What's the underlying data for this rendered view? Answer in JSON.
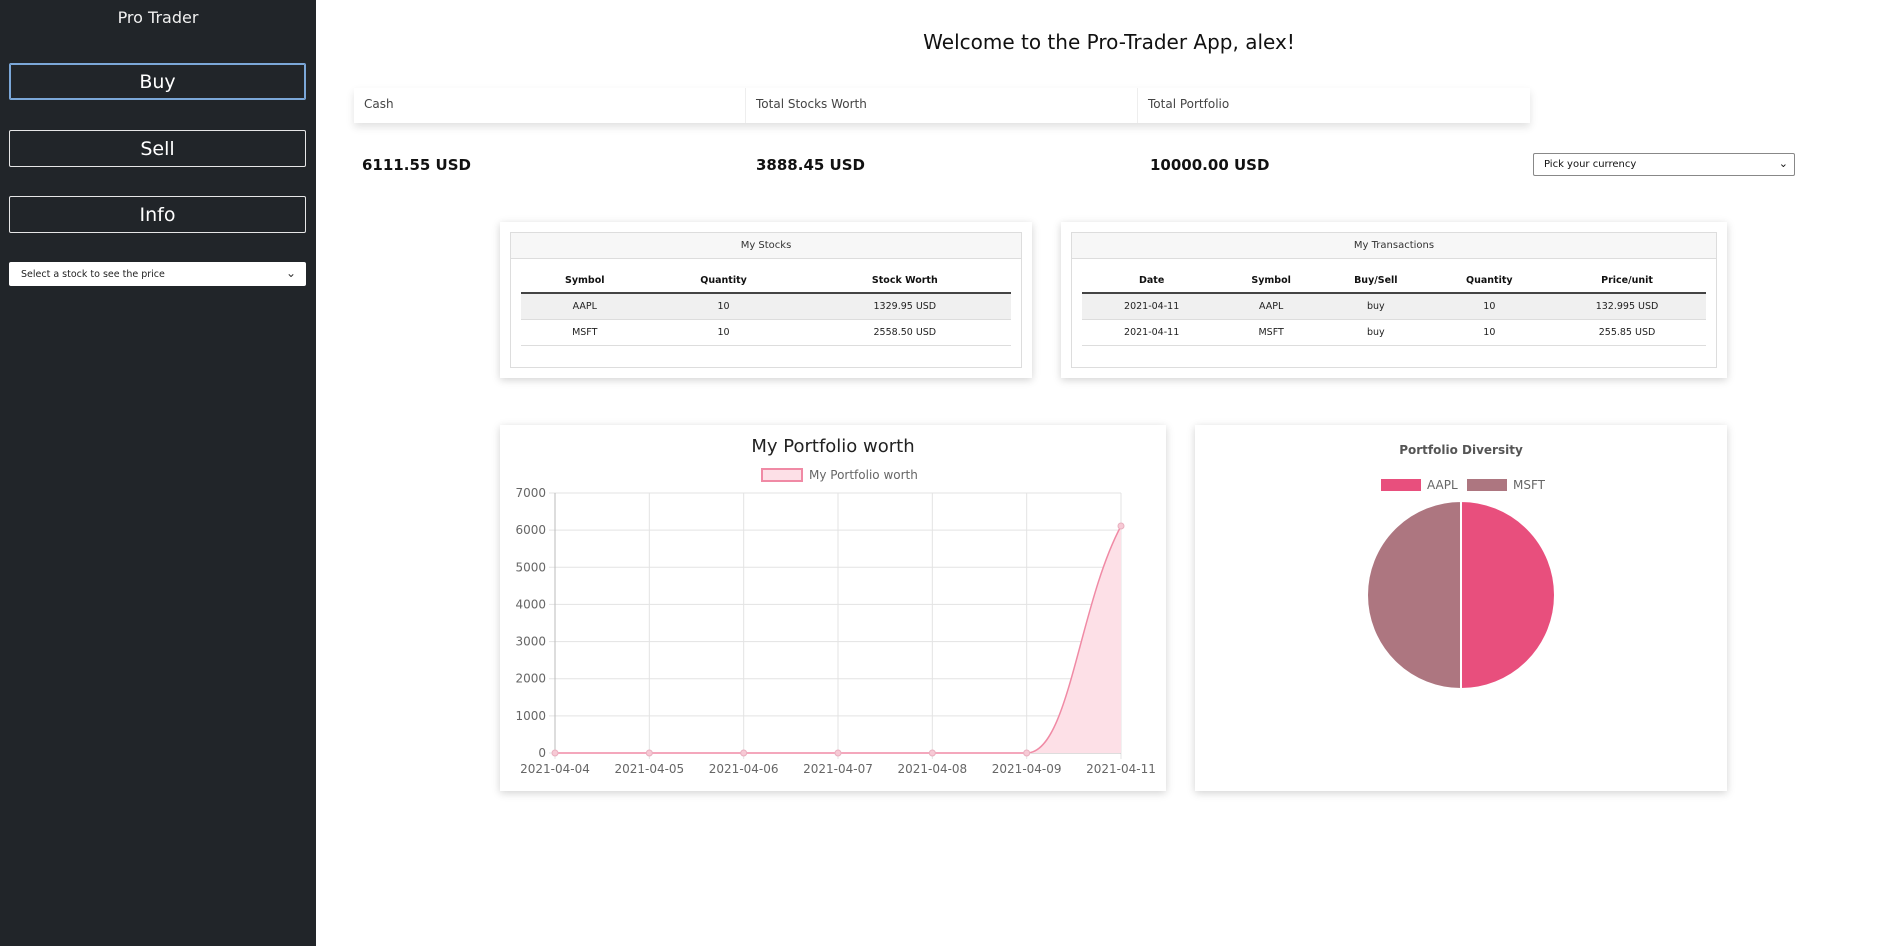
{
  "sidebar": {
    "brand": "Pro Trader",
    "buy_label": "Buy",
    "sell_label": "Sell",
    "info_label": "Info",
    "stock_select_placeholder": "Select a stock to see the price"
  },
  "main": {
    "welcome": "Welcome to the Pro-Trader App, alex!",
    "stats": {
      "cash_label": "Cash",
      "stocks_label": "Total Stocks Worth",
      "portfolio_label": "Total Portfolio",
      "cash_value": "6111.55 USD",
      "stocks_value": "3888.45 USD",
      "portfolio_value": "10000.00 USD"
    },
    "currency_placeholder": "Pick your currency"
  },
  "my_stocks": {
    "title": "My Stocks",
    "headers": [
      "Symbol",
      "Quantity",
      "Stock Worth"
    ],
    "rows": [
      [
        "AAPL",
        "10",
        "1329.95 USD"
      ],
      [
        "MSFT",
        "10",
        "2558.50 USD"
      ]
    ]
  },
  "my_transactions": {
    "title": "My Transactions",
    "headers": [
      "Date",
      "Symbol",
      "Buy/Sell",
      "Quantity",
      "Price/unit"
    ],
    "rows": [
      [
        "2021-04-11",
        "AAPL",
        "buy",
        "10",
        "132.995 USD"
      ],
      [
        "2021-04-11",
        "MSFT",
        "buy",
        "10",
        "255.85 USD"
      ]
    ]
  },
  "colors": {
    "sidebar_bg": "#212529",
    "line": "#f08aa5",
    "line_fill": "#fde0e7",
    "aapl": "#e84f7d",
    "msft": "#ad7680"
  },
  "chart_data": [
    {
      "type": "area",
      "title": "My Portfolio worth",
      "series": [
        {
          "name": "My Portfolio worth",
          "values": [
            0,
            0,
            0,
            0,
            0,
            0,
            6111.55
          ]
        }
      ],
      "x": [
        "2021-04-04",
        "2021-04-05",
        "2021-04-06",
        "2021-04-07",
        "2021-04-08",
        "2021-04-09",
        "2021-04-11"
      ],
      "ylim": [
        0,
        7000
      ],
      "yticks": [
        0,
        1000,
        2000,
        3000,
        4000,
        5000,
        6000,
        7000
      ],
      "grid": true,
      "legend": "top"
    },
    {
      "type": "pie",
      "title": "Portfolio Diversity",
      "categories": [
        "AAPL",
        "MSFT"
      ],
      "values": [
        50,
        50
      ],
      "legend": "top"
    }
  ]
}
